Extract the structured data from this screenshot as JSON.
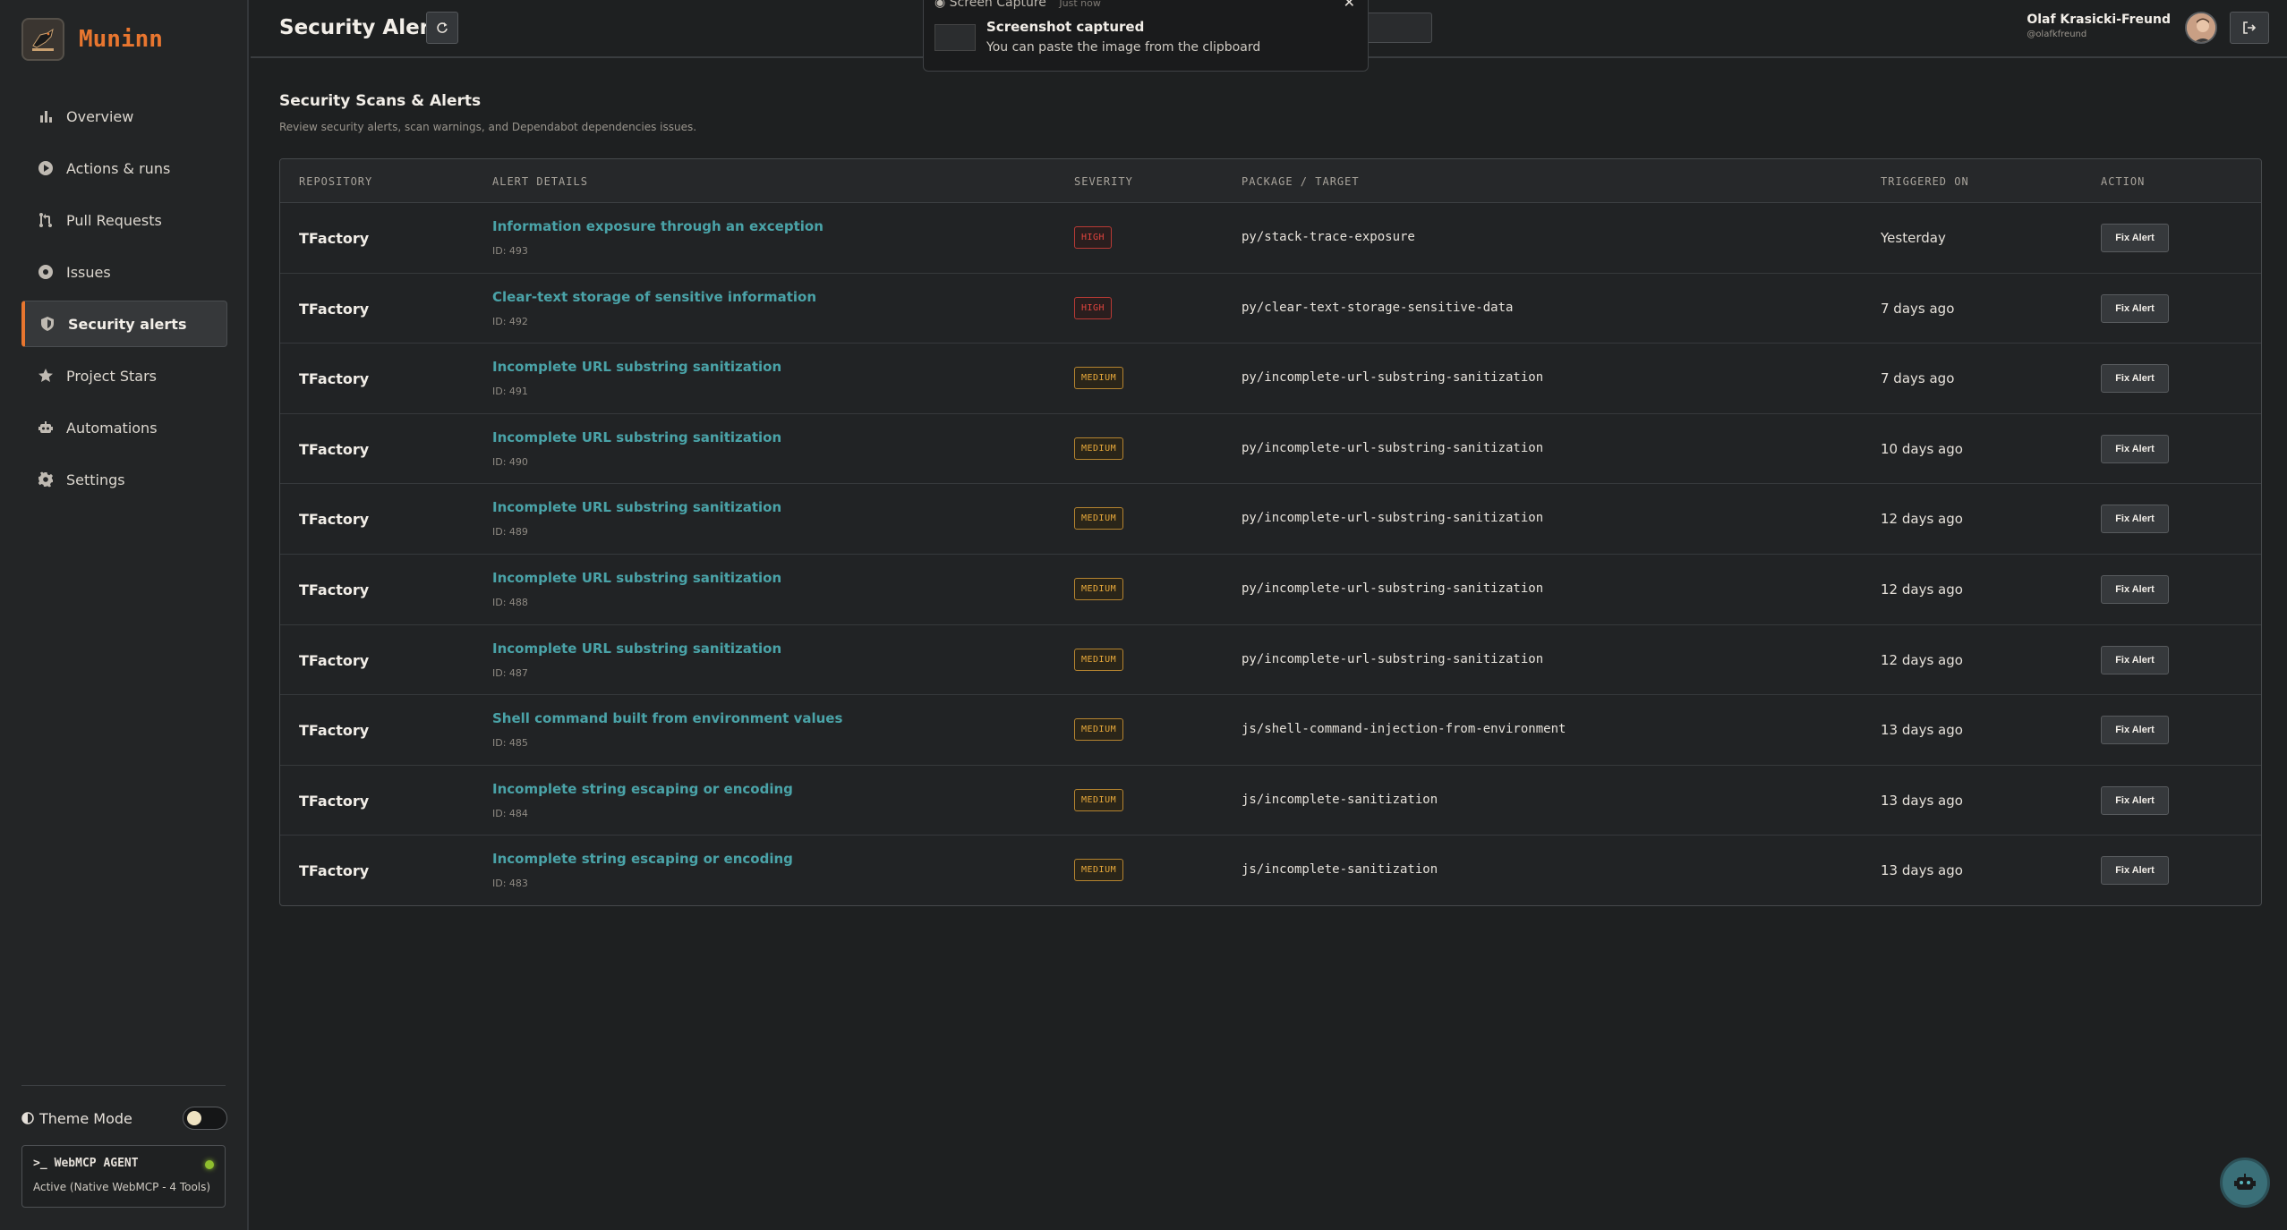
{
  "app": {
    "name": "Muninn"
  },
  "sidebar": {
    "items": [
      {
        "label": "Overview",
        "icon": "bar-chart-icon"
      },
      {
        "label": "Actions & runs",
        "icon": "play-circle-icon"
      },
      {
        "label": "Pull Requests",
        "icon": "git-pull-request-icon"
      },
      {
        "label": "Issues",
        "icon": "issue-circle-icon"
      },
      {
        "label": "Security alerts",
        "icon": "shield-icon",
        "active": true
      },
      {
        "label": "Project Stars",
        "icon": "star-icon"
      },
      {
        "label": "Automations",
        "icon": "robot-icon"
      },
      {
        "label": "Settings",
        "icon": "gear-icon"
      }
    ],
    "theme_label": "Theme Mode",
    "agent": {
      "title": "WebMCP AGENT",
      "status": "Active (Native WebMCP - 4 Tools)"
    }
  },
  "header": {
    "title": "Security Alerts",
    "user": {
      "name": "Olaf Krasicki-Freund",
      "handle": "@olafkfreund"
    }
  },
  "toast": {
    "app": "Screen Capture",
    "time": "Just now",
    "title": "Screenshot captured",
    "message": "You can paste the image from the clipboard"
  },
  "main": {
    "title": "Security Scans & Alerts",
    "subtitle": "Review security alerts, scan warnings, and Dependabot dependencies issues.",
    "columns": [
      "REPOSITORY",
      "ALERT DETAILS",
      "SEVERITY",
      "PACKAGE / TARGET",
      "TRIGGERED ON",
      "ACTION"
    ],
    "action_label": "Fix Alert",
    "rows": [
      {
        "repo": "TFactory",
        "title": "Information exposure through an exception",
        "id": "ID: 493",
        "severity": "HIGH",
        "package": "py/stack-trace-exposure",
        "time": "Yesterday"
      },
      {
        "repo": "TFactory",
        "title": "Clear-text storage of sensitive information",
        "id": "ID: 492",
        "severity": "HIGH",
        "package": "py/clear-text-storage-sensitive-data",
        "time": "7 days ago"
      },
      {
        "repo": "TFactory",
        "title": "Incomplete URL substring sanitization",
        "id": "ID: 491",
        "severity": "MEDIUM",
        "package": "py/incomplete-url-substring-sanitization",
        "time": "7 days ago"
      },
      {
        "repo": "TFactory",
        "title": "Incomplete URL substring sanitization",
        "id": "ID: 490",
        "severity": "MEDIUM",
        "package": "py/incomplete-url-substring-sanitization",
        "time": "10 days ago"
      },
      {
        "repo": "TFactory",
        "title": "Incomplete URL substring sanitization",
        "id": "ID: 489",
        "severity": "MEDIUM",
        "package": "py/incomplete-url-substring-sanitization",
        "time": "12 days ago"
      },
      {
        "repo": "TFactory",
        "title": "Incomplete URL substring sanitization",
        "id": "ID: 488",
        "severity": "MEDIUM",
        "package": "py/incomplete-url-substring-sanitization",
        "time": "12 days ago"
      },
      {
        "repo": "TFactory",
        "title": "Incomplete URL substring sanitization",
        "id": "ID: 487",
        "severity": "MEDIUM",
        "package": "py/incomplete-url-substring-sanitization",
        "time": "12 days ago"
      },
      {
        "repo": "TFactory",
        "title": "Shell command built from environment values",
        "id": "ID: 485",
        "severity": "MEDIUM",
        "package": "js/shell-command-injection-from-environment",
        "time": "13 days ago"
      },
      {
        "repo": "TFactory",
        "title": "Incomplete string escaping or encoding",
        "id": "ID: 484",
        "severity": "MEDIUM",
        "package": "js/incomplete-sanitization",
        "time": "13 days ago"
      },
      {
        "repo": "TFactory",
        "title": "Incomplete string escaping or encoding",
        "id": "ID: 483",
        "severity": "MEDIUM",
        "package": "js/incomplete-sanitization",
        "time": "13 days ago"
      }
    ]
  },
  "colors": {
    "accent": "#e8762f",
    "link": "#4aa3a8",
    "high": "#e0443e",
    "medium": "#e8a93a"
  }
}
